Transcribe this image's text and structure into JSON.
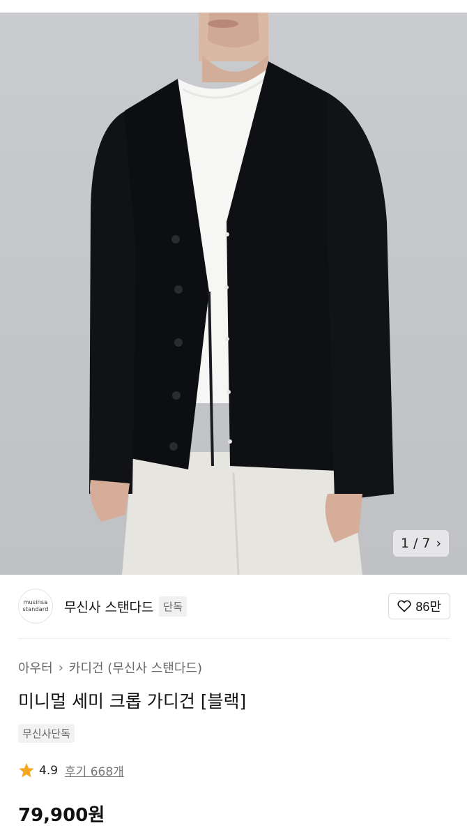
{
  "gallery": {
    "page_current": 1,
    "page_total": 7,
    "counter_text": "1 / 7",
    "next_icon": "chevron-right-icon"
  },
  "brand": {
    "logo_line1": "musinsa",
    "logo_line2": "standard",
    "name": "무신사 스탠다드",
    "badge": "단독",
    "likes": "86만",
    "like_icon": "heart-outline-icon"
  },
  "product": {
    "breadcrumb_1": "아우터",
    "breadcrumb_2": "카디건 (무신사 스탠다드)",
    "title": "미니멀 세미 크롭 가디건 [블랙]",
    "tag": "무신사단독",
    "rating": "4.9",
    "reviews": "후기 668개",
    "price": "79,900원"
  },
  "colors": {
    "star": "#f5a623",
    "background_photo": "#c6c8cc",
    "cardigan": "#0d0e12",
    "tshirt": "#f6f6f4",
    "trousers": "#e7e5df"
  }
}
